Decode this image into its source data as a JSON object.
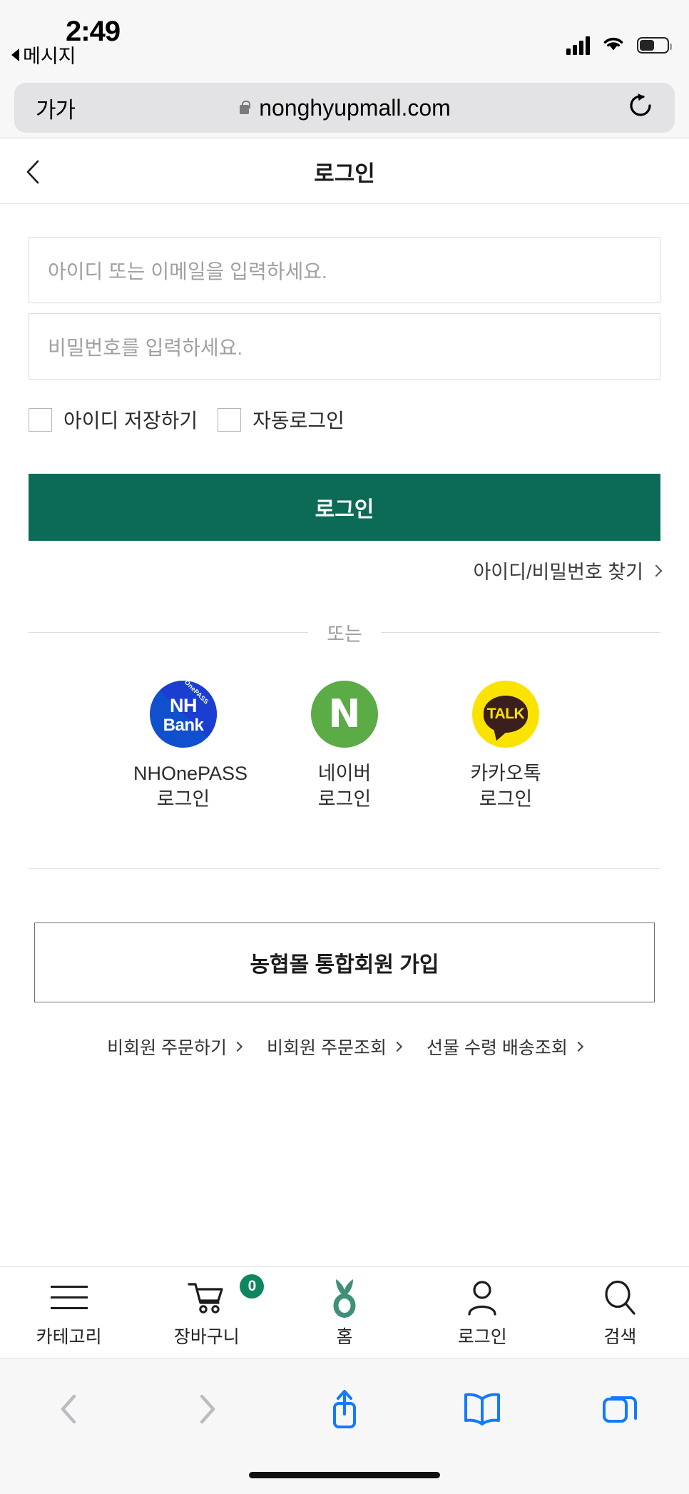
{
  "status_bar": {
    "time": "2:49",
    "back_app": "메시지",
    "icons": [
      "cellular-signal-icon",
      "wifi-icon",
      "battery-icon"
    ]
  },
  "browser": {
    "text_size_label": "가가",
    "lock_icon": "lock-icon",
    "url": "nonghyupmall.com",
    "reload_icon": "reload-icon",
    "toolbar": {
      "back_icon": "chevron-left-icon",
      "forward_icon": "chevron-right-icon",
      "share_icon": "share-icon",
      "bookmarks_icon": "book-icon",
      "tabs_icon": "tabs-icon",
      "accent_color": "#1479ff",
      "disabled_color": "#b9bcc1"
    }
  },
  "page_header": {
    "back_icon": "chevron-left-icon",
    "title": "로그인"
  },
  "login_form": {
    "id_placeholder": "아이디 또는 이메일을 입력하세요.",
    "id_value": "",
    "password_placeholder": "비밀번호를 입력하세요.",
    "password_value": "",
    "checkboxes": [
      {
        "label": "아이디 저장하기",
        "checked": false
      },
      {
        "label": "자동로그인",
        "checked": false
      }
    ],
    "submit_label": "로그인",
    "submit_color": "#0c6b56",
    "find_link": "아이디/비밀번호 찾기"
  },
  "divider": {
    "or_text": "또는"
  },
  "social_logins": [
    {
      "provider": "nhonepass",
      "badge_text_top": "NH",
      "badge_text_bottom": "Bank",
      "ribbon": "OnePASS",
      "label_line1": "NHOnePASS",
      "label_line2": "로그인",
      "color": "#1050cf"
    },
    {
      "provider": "naver",
      "badge_text": "N",
      "label_line1": "네이버",
      "label_line2": "로그인",
      "color": "#5bab46"
    },
    {
      "provider": "kakaotalk",
      "badge_text": "TALK",
      "label_line1": "카카오톡",
      "label_line2": "로그인",
      "color": "#fbe300"
    }
  ],
  "signup": {
    "button_label": "농협몰 통합회원 가입",
    "guest_links": [
      "비회원 주문하기",
      "비회원 주문조회",
      "선물 수령 배송조회"
    ]
  },
  "tabbar": {
    "items": [
      {
        "icon": "hamburger-icon",
        "label": "카테고리",
        "badge": null
      },
      {
        "icon": "cart-icon",
        "label": "장바구니",
        "badge": "0"
      },
      {
        "icon": "home-sprout-icon",
        "label": "홈",
        "badge": null
      },
      {
        "icon": "person-icon",
        "label": "로그인",
        "badge": null
      },
      {
        "icon": "search-icon",
        "label": "검색",
        "badge": null
      }
    ],
    "badge_color": "#0f8560",
    "home_icon_color": "#3e9078"
  }
}
